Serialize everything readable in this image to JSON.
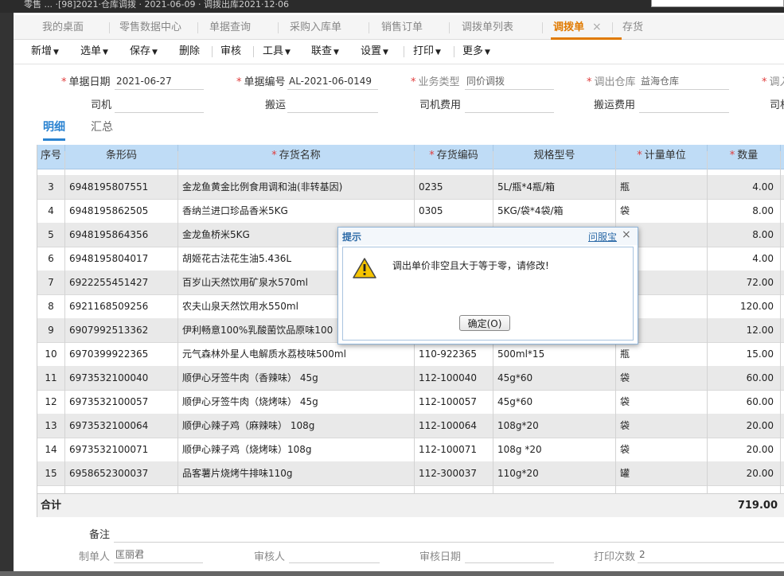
{
  "window": {
    "title": "零售 ... ·[98]2021·仓库调拨 · 2021-06-09 · 调拨出库2021·12·06"
  },
  "tabs": [
    {
      "label": "我的桌面"
    },
    {
      "label": "零售数据中心"
    },
    {
      "label": "单据查询"
    },
    {
      "label": "采购入库单"
    },
    {
      "label": "销售订单"
    },
    {
      "label": "调拨单列表"
    },
    {
      "label": "调拨单",
      "active": true,
      "close": "×"
    },
    {
      "label": "存货"
    }
  ],
  "toolbar": [
    {
      "label": "新增",
      "dropdown": true
    },
    {
      "label": "选单",
      "dropdown": true
    },
    {
      "label": "保存",
      "dropdown": true
    },
    {
      "label": "删除",
      "dropdown": false
    },
    {
      "label": "审核",
      "dropdown": false
    },
    {
      "label": "工具",
      "dropdown": true
    },
    {
      "label": "联查",
      "dropdown": true
    },
    {
      "label": "设置",
      "dropdown": true
    },
    {
      "label": "打印",
      "dropdown": true
    },
    {
      "label": "更多",
      "dropdown": true
    }
  ],
  "form": {
    "date_label": "单据日期",
    "date_value": "2021-06-27",
    "no_label": "单据编号",
    "no_value": "AL-2021-06-0149",
    "biz_label": "业务类型",
    "biz_value": "同价调拨",
    "out_wh_label": "调出仓库",
    "out_wh_value": "益海仓库",
    "in_wh_label": "调入",
    "driver_label": "司机",
    "driver_value": "",
    "carry_label": "搬运",
    "carry_value": "",
    "driver_fee_label": "司机费用",
    "driver_fee_value": "",
    "carry_fee_label": "搬运费用",
    "carry_fee_value": "",
    "driver2_label": "司机"
  },
  "subtabs": [
    {
      "label": "明细",
      "active": true
    },
    {
      "label": "汇总"
    }
  ],
  "grid": {
    "headers": [
      {
        "label": "序号",
        "required": false
      },
      {
        "label": "条形码",
        "required": false
      },
      {
        "label": "存货名称",
        "required": true
      },
      {
        "label": "存货编码",
        "required": true
      },
      {
        "label": "规格型号",
        "required": false
      },
      {
        "label": "计量单位",
        "required": true
      },
      {
        "label": "数量",
        "required": true
      }
    ],
    "rows": [
      {
        "idx": "3",
        "barcode": "6948195807551",
        "name": "金龙鱼黄金比例食用调和油(非转基因)",
        "code": "0235",
        "spec": "5L/瓶*4瓶/箱",
        "unit": "瓶",
        "qty": "4.00"
      },
      {
        "idx": "4",
        "barcode": "6948195862505",
        "name": "香纳兰进口珍品香米5KG",
        "code": "0305",
        "spec": "5KG/袋*4袋/箱",
        "unit": "袋",
        "qty": "8.00"
      },
      {
        "idx": "5",
        "barcode": "6948195864356",
        "name": "金龙鱼桥米5KG",
        "code": "",
        "spec": "",
        "unit": "",
        "qty": "8.00"
      },
      {
        "idx": "6",
        "barcode": "6948195804017",
        "name": "胡姬花古法花生油5.436L",
        "code": "",
        "spec": "",
        "unit": "",
        "qty": "4.00"
      },
      {
        "idx": "7",
        "barcode": "6922255451427",
        "name": "百岁山天然饮用矿泉水570ml",
        "code": "",
        "spec": "",
        "unit": "",
        "qty": "72.00"
      },
      {
        "idx": "8",
        "barcode": "6921168509256",
        "name": "农夫山泉天然饮用水550ml",
        "code": "",
        "spec": "",
        "unit": "",
        "qty": "120.00"
      },
      {
        "idx": "9",
        "barcode": "6907992513362",
        "name": "伊利畅意100%乳酸菌饮品原味100",
        "code": "",
        "spec": "",
        "unit": "",
        "qty": "12.00"
      },
      {
        "idx": "10",
        "barcode": "6970399922365",
        "name": "元气森林外星人电解质水荔枝味500ml",
        "code": "110-922365",
        "spec": "500ml*15",
        "unit": "瓶",
        "qty": "15.00"
      },
      {
        "idx": "11",
        "barcode": "6973532100040",
        "name": "顺伊心牙签牛肉（香辣味） 45g",
        "code": "112-100040",
        "spec": "45g*60",
        "unit": "袋",
        "qty": "60.00"
      },
      {
        "idx": "12",
        "barcode": "6973532100057",
        "name": "顺伊心牙签牛肉（烧烤味） 45g",
        "code": "112-100057",
        "spec": "45g*60",
        "unit": "袋",
        "qty": "60.00"
      },
      {
        "idx": "13",
        "barcode": "6973532100064",
        "name": "顺伊心辣子鸡（麻辣味） 108g",
        "code": "112-100064",
        "spec": "108g*20",
        "unit": "袋",
        "qty": "20.00"
      },
      {
        "idx": "14",
        "barcode": "6973532100071",
        "name": "顺伊心辣子鸡（烧烤味）108g",
        "code": "112-100071",
        "spec": "108g *20",
        "unit": "袋",
        "qty": "20.00"
      },
      {
        "idx": "15",
        "barcode": "6958652300037",
        "name": "品客薯片烧烤牛排味110g",
        "code": "112-300037",
        "spec": "110g*20",
        "unit": "罐",
        "qty": "20.00"
      }
    ],
    "total_label": "合计",
    "total_qty": "719.00"
  },
  "footer": {
    "remark_label": "备注",
    "remark_value": "",
    "maker_label": "制单人",
    "maker_value": "匡丽君",
    "auditor_label": "审核人",
    "auditor_value": "",
    "audit_date_label": "审核日期",
    "audit_date_value": "",
    "print_count_label": "打印次数",
    "print_count_value": "2"
  },
  "dialog": {
    "title": "提示",
    "help_link": "问服宝",
    "close": "×",
    "icon": "warning-icon",
    "message": "调出单价非空且大于等于零，请修改!",
    "ok_button": "确定(O)"
  },
  "colors": {
    "accent_orange": "#e07a00",
    "accent_blue": "#2a83d1",
    "grid_header": "#bfdcf6",
    "required": "#e03c3c"
  }
}
